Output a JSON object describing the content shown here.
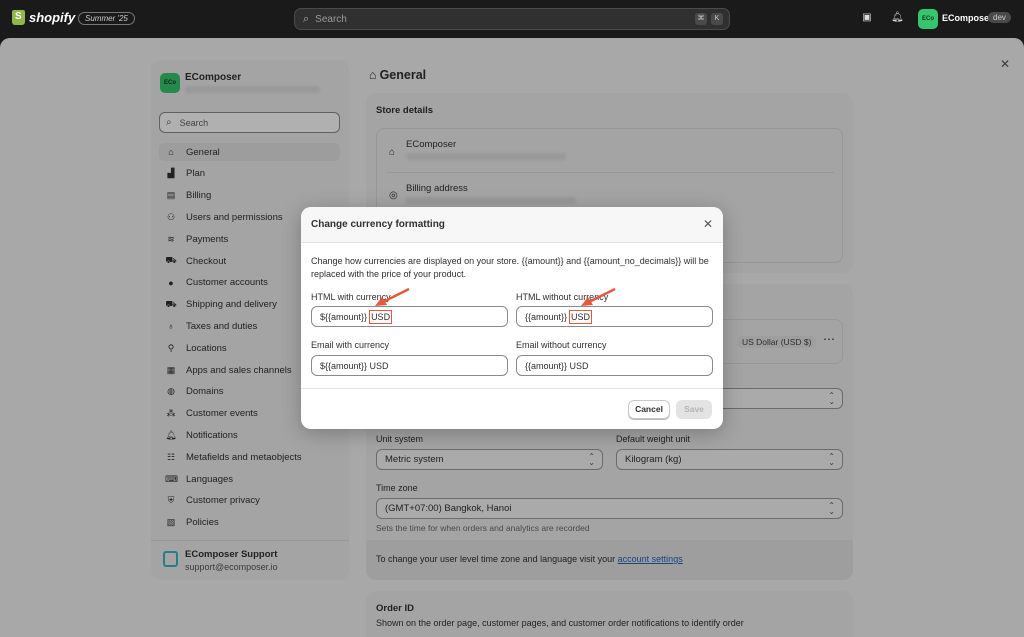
{
  "topbar": {
    "brand": "shopify",
    "edition_badge": "Summer '25",
    "search_placeholder": "Search",
    "shortcut_keys": [
      "⌘",
      "K"
    ],
    "store_initials": "ECo",
    "store_name": "EComposer",
    "env_badge": "dev"
  },
  "sidebar": {
    "store_initials": "ECo",
    "store_name": "EComposer",
    "search_placeholder": "Search",
    "items": [
      {
        "label": "General",
        "icon": "store-icon",
        "active": true
      },
      {
        "label": "Plan",
        "icon": "plan-icon"
      },
      {
        "label": "Billing",
        "icon": "billing-icon"
      },
      {
        "label": "Users and permissions",
        "icon": "users-icon"
      },
      {
        "label": "Payments",
        "icon": "payments-icon"
      },
      {
        "label": "Checkout",
        "icon": "cart-icon"
      },
      {
        "label": "Customer accounts",
        "icon": "person-icon"
      },
      {
        "label": "Shipping and delivery",
        "icon": "truck-icon"
      },
      {
        "label": "Taxes and duties",
        "icon": "tax-icon"
      },
      {
        "label": "Locations",
        "icon": "location-icon"
      },
      {
        "label": "Apps and sales channels",
        "icon": "apps-icon"
      },
      {
        "label": "Domains",
        "icon": "globe-icon"
      },
      {
        "label": "Customer events",
        "icon": "events-icon"
      },
      {
        "label": "Notifications",
        "icon": "bell-icon"
      },
      {
        "label": "Metafields and metaobjects",
        "icon": "metafields-icon"
      },
      {
        "label": "Languages",
        "icon": "languages-icon"
      },
      {
        "label": "Customer privacy",
        "icon": "lock-icon"
      },
      {
        "label": "Policies",
        "icon": "policies-icon"
      }
    ],
    "support": {
      "name": "EComposer Support",
      "email": "support@ecomposer.io"
    }
  },
  "main": {
    "title": "General",
    "store_details": {
      "heading": "Store details",
      "store_name": "EComposer",
      "billing_label": "Billing address"
    },
    "store_defaults": {
      "currency_value": "US Dollar (USD $)",
      "unit_system_label": "Unit system",
      "unit_system_value": "Metric system",
      "weight_unit_label": "Default weight unit",
      "weight_unit_value": "Kilogram (kg)",
      "timezone_label": "Time zone",
      "timezone_value": "(GMT+07:00) Bangkok, Hanoi",
      "timezone_help": "Sets the time for when orders and analytics are recorded",
      "account_note_prefix": "To change your user level time zone and language visit your ",
      "account_link": "account settings"
    },
    "order_id": {
      "heading": "Order ID",
      "help": "Shown on the order page, customer pages, and customer order notifications to identify order"
    }
  },
  "modal": {
    "title": "Change currency formatting",
    "description": "Change how currencies are displayed on your store. {{amount}} and {{amount_no_decimals}} will be replaced with the price of your product.",
    "fields": {
      "html_with": {
        "label": "HTML with currency",
        "value_main": "${{amount}}",
        "value_suffix": "USD"
      },
      "html_without": {
        "label": "HTML without currency",
        "value_main": "{{amount}}",
        "value_suffix": "USD"
      },
      "email_with": {
        "label": "Email with currency",
        "value": "${{amount}} USD"
      },
      "email_without": {
        "label": "Email without currency",
        "value": "{{amount}} USD"
      }
    },
    "cancel_label": "Cancel",
    "save_label": "Save"
  },
  "colors": {
    "highlight": "#e8573f",
    "accent_green": "#36c56e",
    "link": "#2463bc"
  }
}
